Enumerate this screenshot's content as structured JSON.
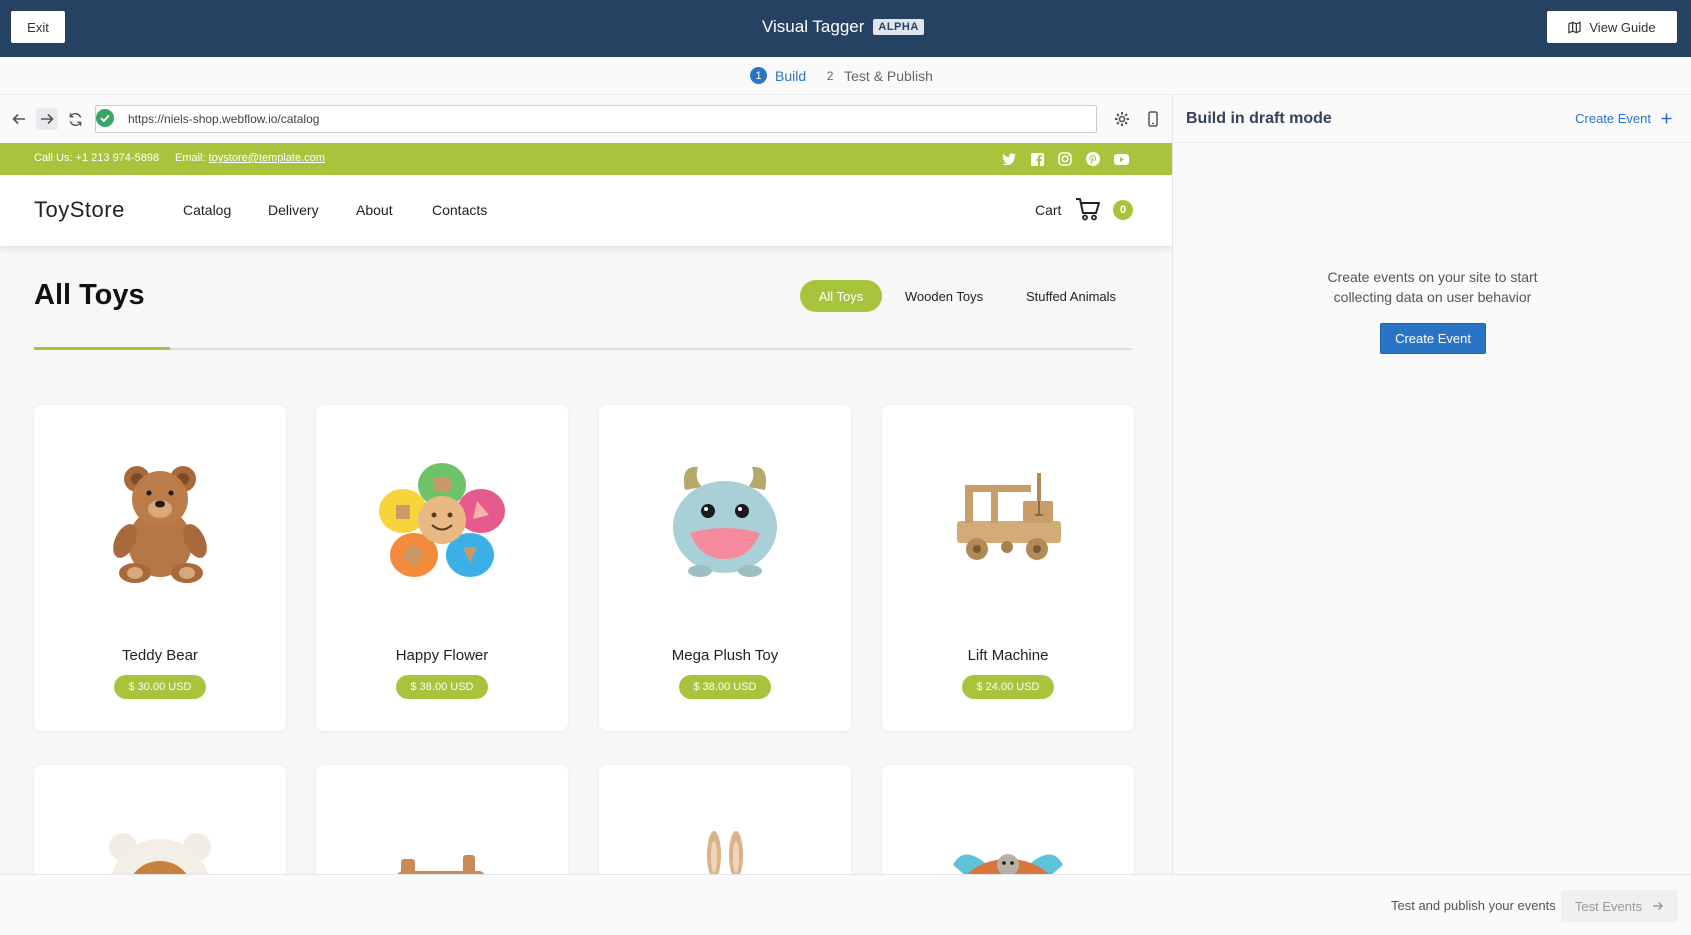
{
  "app": {
    "exit_label": "Exit",
    "title": "Visual Tagger",
    "badge": "ALPHA",
    "guide_label": "View Guide"
  },
  "steps": [
    {
      "num": "1",
      "label": "Build",
      "active": true
    },
    {
      "num": "2",
      "label": "Test & Publish",
      "active": false
    }
  ],
  "browser": {
    "url": "https://niels-shop.webflow.io/catalog"
  },
  "panel": {
    "title": "Build in draft mode",
    "create_link": "Create Event",
    "empty_line1": "Create events on your site to start",
    "empty_line2": "collecting data on user behavior",
    "create_button": "Create Event"
  },
  "footer": {
    "text": "Test and publish your events",
    "button": "Test Events"
  },
  "site": {
    "phone": "Call Us: +1 213 974-5898",
    "email_label": "Email:",
    "email": "toystore@template.com",
    "logo": "ToyStore",
    "nav": [
      "Catalog",
      "Delivery",
      "About",
      "Contacts"
    ],
    "cart_label": "Cart",
    "cart_count": "0",
    "page_title": "All Toys",
    "filters": [
      "All Toys",
      "Wooden Toys",
      "Stuffed Animals"
    ],
    "products": [
      {
        "name": "Teddy Bear",
        "price": "$ 30.00 USD"
      },
      {
        "name": "Happy Flower",
        "price": "$ 38.00 USD"
      },
      {
        "name": "Mega Plush Toy",
        "price": "$ 38.00 USD"
      },
      {
        "name": "Lift Machine",
        "price": "$ 24.00 USD"
      }
    ]
  },
  "colors": {
    "topbar": "#264262",
    "accent_green": "#a8c43c",
    "primary_blue": "#2a74c6"
  }
}
